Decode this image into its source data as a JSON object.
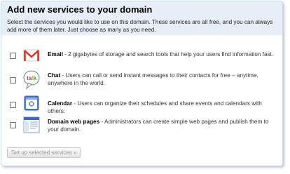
{
  "title": "Add new services to your domain",
  "intro": "Select the services you would like to use on this domain. These services are all free, and you can always add more of them later. Just choose as many as you need.",
  "services": [
    {
      "name": "Email",
      "description": " - 2 gigabytes of storage and search tools that help your users find information fast.",
      "icon": "gmail-icon",
      "checked": false
    },
    {
      "name": "Chat",
      "description": " - Users can call or send instant messages to their contacts for free – anytime, anywhere in the world.",
      "icon": "talk-icon",
      "checked": false
    },
    {
      "name": "Calendar",
      "description": " - Users can organize their schedules and share events and calendars with others.",
      "icon": "calendar-icon",
      "checked": false
    },
    {
      "name": "Domain web pages",
      "description": " - Administrators can create simple web pages and publish them to your domain.",
      "icon": "web-pages-icon",
      "checked": false
    }
  ],
  "setup_button": "Set up selected services »",
  "colors": {
    "header_bg": "#e8eef7",
    "border": "#c3d9ff"
  }
}
